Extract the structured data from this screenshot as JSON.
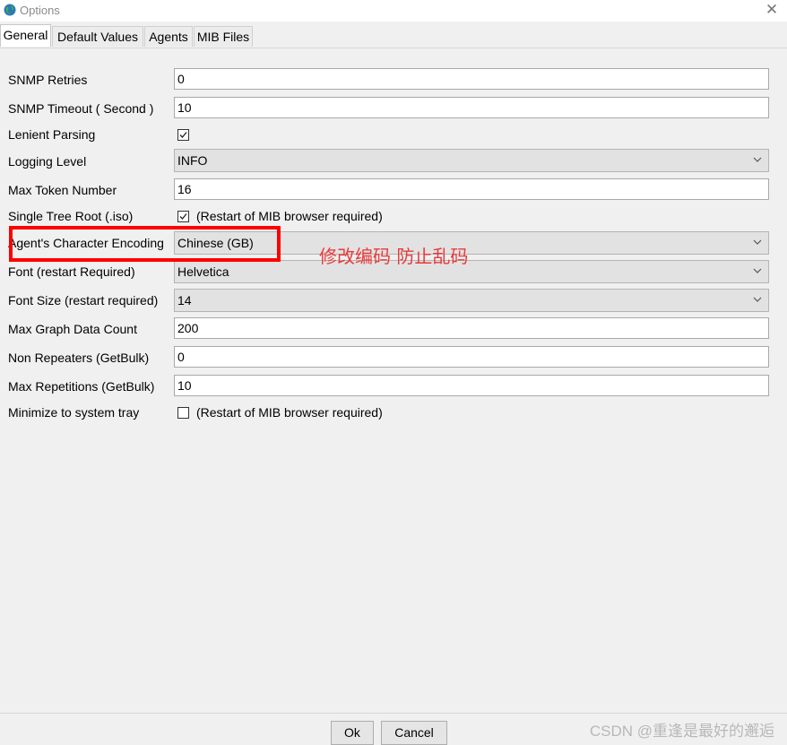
{
  "window": {
    "title": "Options",
    "close_glyph": "✕"
  },
  "tabs": [
    {
      "label": "General",
      "active": true
    },
    {
      "label": "Default Values",
      "active": false
    },
    {
      "label": "Agents",
      "active": false
    },
    {
      "label": "MIB Files",
      "active": false
    }
  ],
  "settings": {
    "snmp_retries": {
      "label": "SNMP Retries",
      "value": "0"
    },
    "snmp_timeout": {
      "label": "SNMP Timeout ( Second )",
      "value": "10"
    },
    "lenient_parsing": {
      "label": "Lenient Parsing",
      "checked": true
    },
    "logging_level": {
      "label": "Logging Level",
      "value": "INFO"
    },
    "max_token_number": {
      "label": "Max Token Number",
      "value": "16"
    },
    "single_tree_root": {
      "label": "Single Tree Root (.iso)",
      "checked": true,
      "note": "(Restart of MIB browser required)"
    },
    "agent_char_encoding": {
      "label": "Agent's Character Encoding",
      "value": "Chinese (GB)"
    },
    "font": {
      "label": "Font (restart Required)",
      "value": "Helvetica"
    },
    "font_size": {
      "label": "Font Size (restart required)",
      "value": "14"
    },
    "max_graph_data_count": {
      "label": "Max Graph Data Count",
      "value": "200"
    },
    "non_repeaters": {
      "label": "Non Repeaters (GetBulk)",
      "value": "0"
    },
    "max_repetitions": {
      "label": "Max Repetitions (GetBulk)",
      "value": "10"
    },
    "minimize_to_tray": {
      "label": "Minimize to system tray",
      "checked": false,
      "note": "(Restart of MIB browser required)"
    }
  },
  "annotation": {
    "text": "修改编码  防止乱码",
    "color": "#e83a3a",
    "box_color": "#ff0000"
  },
  "buttons": {
    "ok": "Ok",
    "cancel": "Cancel"
  },
  "watermark": "CSDN @重逢是最好的邂逅",
  "icons": {
    "app": "globe-icon",
    "dropdown": "chevron-down-icon",
    "check": "checkmark-icon"
  }
}
